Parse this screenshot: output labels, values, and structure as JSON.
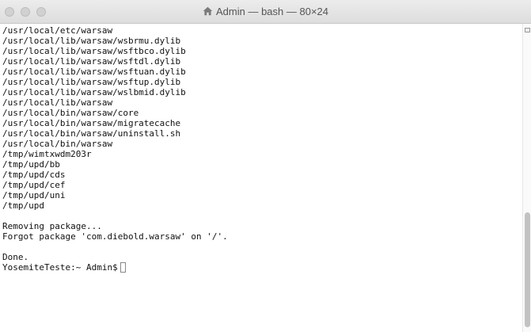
{
  "window": {
    "title": "Admin — bash — 80×24",
    "title_icon": "home-icon"
  },
  "terminal": {
    "lines": [
      "/usr/local/etc/warsaw",
      "/usr/local/lib/warsaw/wsbrmu.dylib",
      "/usr/local/lib/warsaw/wsftbco.dylib",
      "/usr/local/lib/warsaw/wsftdl.dylib",
      "/usr/local/lib/warsaw/wsftuan.dylib",
      "/usr/local/lib/warsaw/wsftup.dylib",
      "/usr/local/lib/warsaw/wslbmid.dylib",
      "/usr/local/lib/warsaw",
      "/usr/local/bin/warsaw/core",
      "/usr/local/bin/warsaw/migratecache",
      "/usr/local/bin/warsaw/uninstall.sh",
      "/usr/local/bin/warsaw",
      "/tmp/wimtxwdm203r",
      "/tmp/upd/bb",
      "/tmp/upd/cds",
      "/tmp/upd/cef",
      "/tmp/upd/uni",
      "/tmp/upd",
      "",
      "Removing package...",
      "Forgot package 'com.diebold.warsaw' on '/'.",
      "",
      "Done."
    ],
    "prompt": "YosemiteTeste:~ Admin$"
  },
  "colors": {
    "background": "#ffffff",
    "text": "#111111",
    "titlebar": "#e4e4e4"
  }
}
